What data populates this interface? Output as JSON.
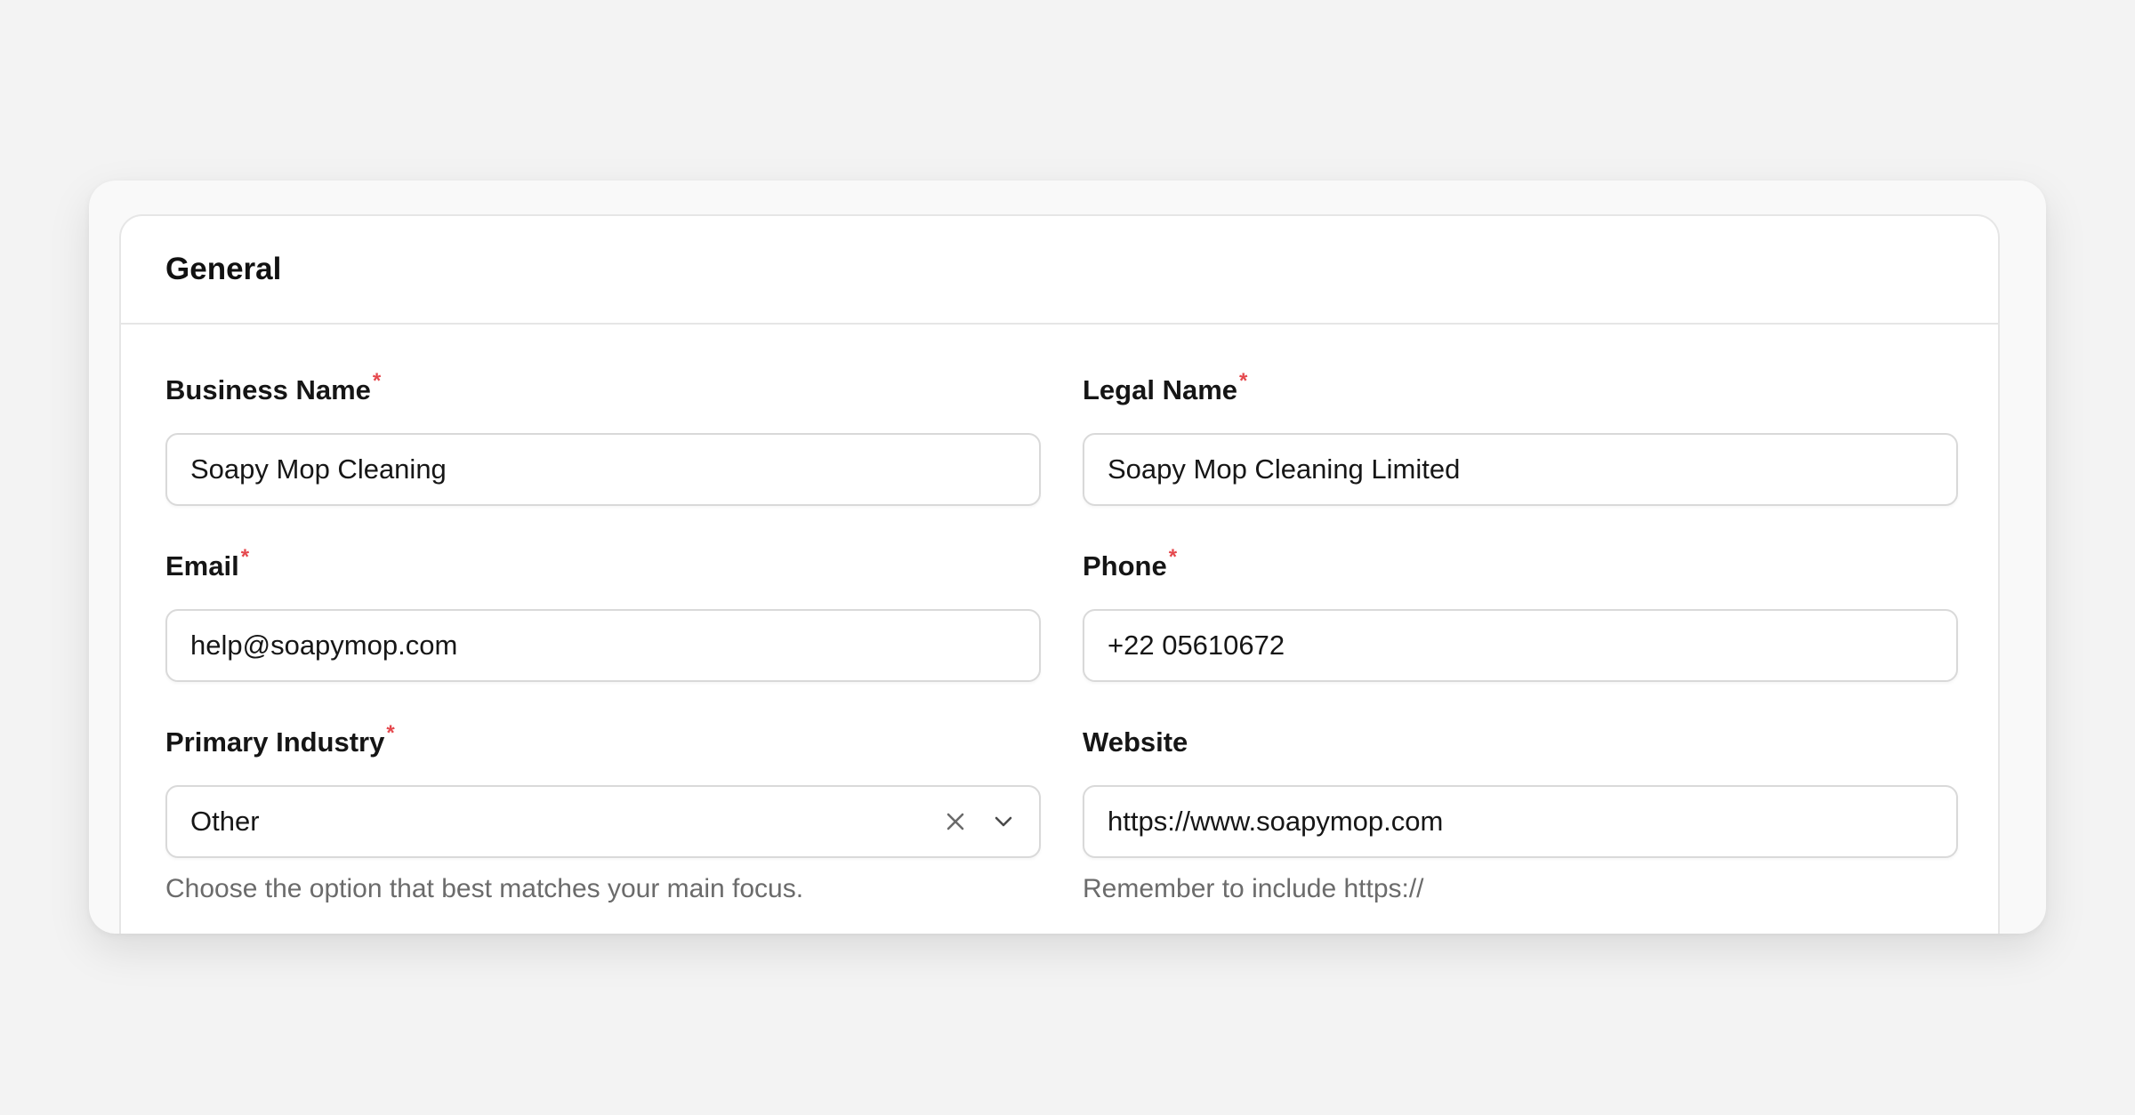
{
  "section": {
    "title": "General"
  },
  "required_marker": "*",
  "fields": {
    "business_name": {
      "label": "Business Name",
      "value": "Soapy Mop Cleaning",
      "required": true
    },
    "legal_name": {
      "label": "Legal Name",
      "value": "Soapy Mop Cleaning Limited",
      "required": true
    },
    "email": {
      "label": "Email",
      "value": "help@soapymop.com",
      "required": true
    },
    "phone": {
      "label": "Phone",
      "value": "+22 05610672",
      "required": true
    },
    "primary_industry": {
      "label": "Primary Industry",
      "value": "Other",
      "required": true,
      "help": "Choose the option that best matches your main focus."
    },
    "website": {
      "label": "Website",
      "value": "https://www.soapymop.com",
      "required": false,
      "help": "Remember to include https://"
    }
  },
  "icons": {
    "clear": "close-icon",
    "dropdown": "chevron-down-icon"
  },
  "colors": {
    "page_background": "#f3f3f3",
    "required_star": "#e5484d",
    "help_text": "#6b6b6b",
    "border": "#d9d9d9"
  }
}
